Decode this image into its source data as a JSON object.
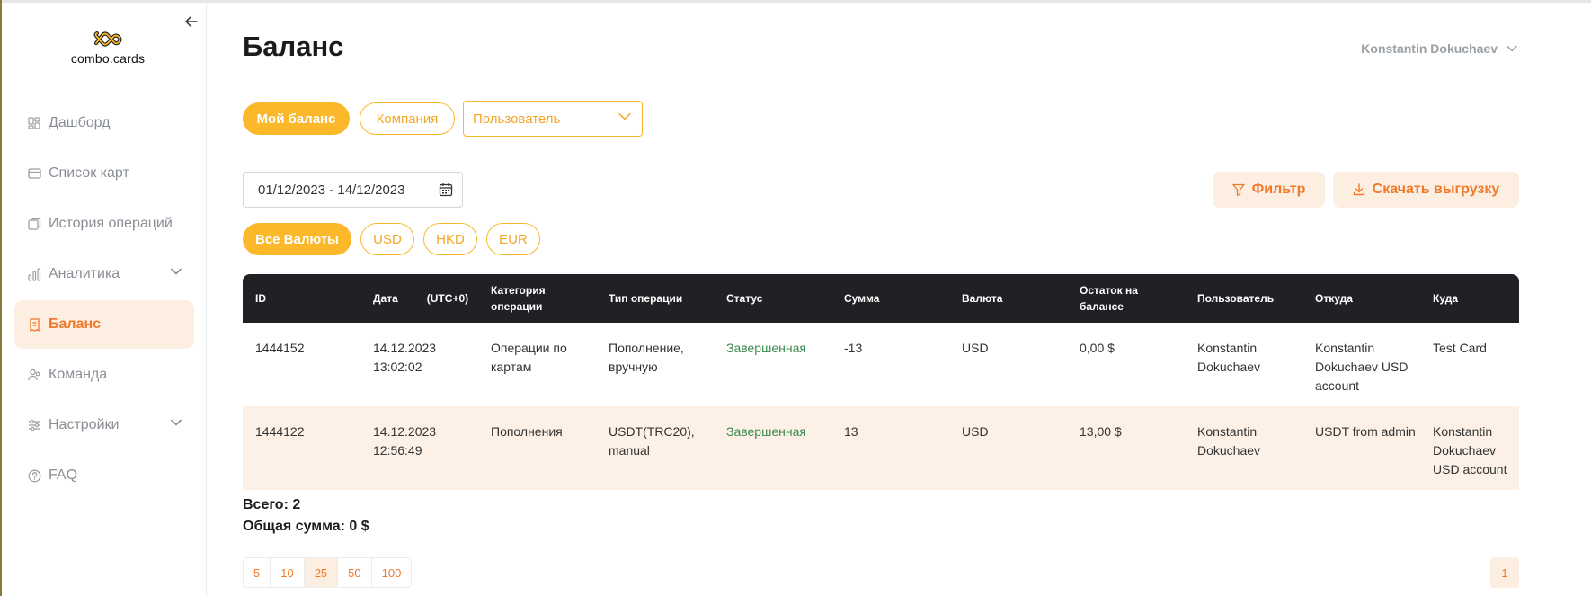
{
  "app": {
    "logo_text": "combo.cards"
  },
  "sidebar": {
    "items": [
      {
        "label": "Дашборд",
        "icon": "dashboard-icon"
      },
      {
        "label": "Список карт",
        "icon": "card-icon"
      },
      {
        "label": "История операций",
        "icon": "history-icon"
      },
      {
        "label": "Аналитика",
        "icon": "analytics-icon",
        "expandable": true
      },
      {
        "label": "Баланс",
        "icon": "balance-icon",
        "active": true
      },
      {
        "label": "Команда",
        "icon": "team-icon"
      },
      {
        "label": "Настройки",
        "icon": "settings-icon",
        "expandable": true
      },
      {
        "label": "FAQ",
        "icon": "faq-icon"
      }
    ]
  },
  "header": {
    "title": "Баланс",
    "user_name": "Konstantin Dokuchaev"
  },
  "scope_tabs": {
    "my_balance": "Мой баланс",
    "company": "Компания",
    "user_select_placeholder": "Пользователь"
  },
  "date_range": "01/12/2023 - 14/12/2023",
  "actions": {
    "filter": "Фильтр",
    "download": "Скачать выгрузку"
  },
  "currency_tabs": {
    "all": "Все Валюты",
    "usd": "USD",
    "hkd": "HKD",
    "eur": "EUR"
  },
  "table": {
    "headers": {
      "id": "ID",
      "date": "Дата",
      "tz": "(UTC+0)",
      "category": "Категория операции",
      "type": "Тип операции",
      "status": "Статус",
      "amount": "Сумма",
      "currency": "Валюта",
      "remaining": "Остаток на балансе",
      "user": "Пользователь",
      "from": "Откуда",
      "to": "Куда"
    },
    "rows": [
      {
        "id": "1444152",
        "date": "14.12.2023 13:02:02",
        "category": "Операции по картам",
        "type": "Пополнение, вручную",
        "status": "Завершенная",
        "amount": "-13",
        "currency": "USD",
        "remaining": "0,00 $",
        "user": "Konstantin Dokuchaev",
        "from": "Konstantin Dokuchaev USD account",
        "to": "Test Card"
      },
      {
        "id": "1444122",
        "date": "14.12.2023 12:56:49",
        "category": "Пополнения",
        "type": "USDT(TRC20), manual",
        "status": "Завершенная",
        "amount": "13",
        "currency": "USD",
        "remaining": "13,00 $",
        "user": "Konstantin Dokuchaev",
        "from": "USDT from admin",
        "to": "Konstantin Dokuchaev USD account"
      }
    ]
  },
  "totals": {
    "count": "Всего: 2",
    "sum": "Общая сумма: 0 $"
  },
  "pagination": {
    "sizes": [
      "5",
      "10",
      "25",
      "50",
      "100"
    ],
    "active_size": "25",
    "current_page": "1"
  },
  "colors": {
    "accent": "#fbb82b",
    "accent_text": "#f07a2a",
    "soft_bg": "#fdeee2",
    "header_bg": "#1f2124",
    "status_ok": "#3a8a4e"
  }
}
